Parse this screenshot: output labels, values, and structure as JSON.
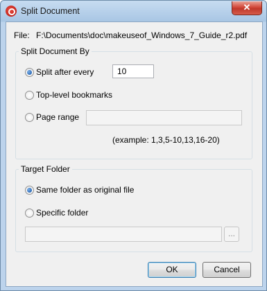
{
  "window": {
    "title": "Split Document",
    "close_symbol": "✕"
  },
  "file": {
    "label": "File:",
    "path": "F:\\Documents\\doc\\makeuseof_Windows_7_Guide_r2.pdf"
  },
  "split_group": {
    "title": "Split Document By",
    "options": [
      {
        "label": "Split after every",
        "checked": true
      },
      {
        "label": "Top-level bookmarks",
        "checked": false
      },
      {
        "label": "Page range",
        "checked": false
      }
    ],
    "split_value": "10",
    "page_range_value": "",
    "example": "(example: 1,3,5-10,13,16-20)"
  },
  "target_group": {
    "title": "Target Folder",
    "options": [
      {
        "label": "Same folder as original file",
        "checked": true
      },
      {
        "label": "Specific folder",
        "checked": false
      }
    ],
    "folder_value": "",
    "browse_label": "..."
  },
  "buttons": {
    "ok": "OK",
    "cancel": "Cancel"
  }
}
